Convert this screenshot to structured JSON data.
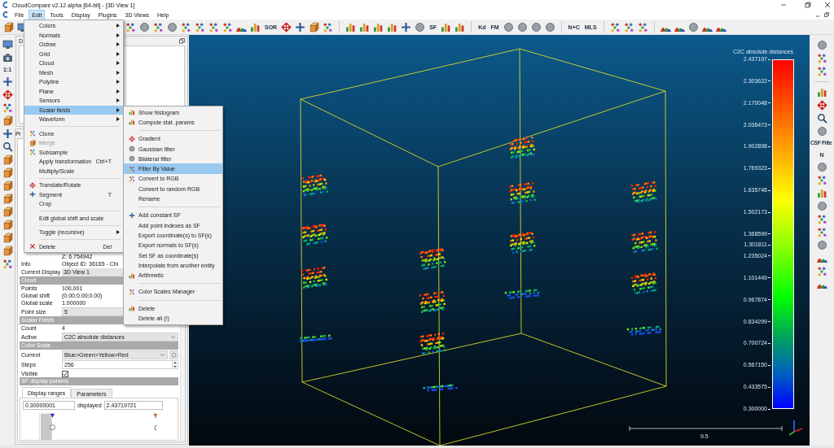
{
  "window": {
    "title": "CloudCompare v2.12 alpha [64-bit] - [3D View 1]"
  },
  "menubar": [
    {
      "label": "File",
      "selected": false
    },
    {
      "label": "Edit",
      "selected": true
    },
    {
      "label": "Tools",
      "selected": false
    },
    {
      "label": "Display",
      "selected": false
    },
    {
      "label": "Plugins",
      "selected": false
    },
    {
      "label": "3D Views",
      "selected": false
    },
    {
      "label": "Help",
      "selected": false
    }
  ],
  "toolbar": [
    {
      "kind": "cube"
    },
    {
      "kind": "screen"
    },
    {
      "kind": "gap"
    },
    {
      "kind": "dots"
    },
    {
      "kind": "circle"
    },
    {
      "kind": "dots"
    },
    {
      "kind": "circle"
    },
    {
      "kind": "dots"
    },
    {
      "kind": "dots"
    },
    {
      "kind": "dots"
    },
    {
      "kind": "dots"
    },
    {
      "kind": "hill"
    },
    {
      "kind": "chart"
    },
    {
      "kind": "label",
      "label": "SOR"
    },
    {
      "kind": "cross"
    },
    {
      "kind": "plus"
    },
    {
      "kind": "cube"
    },
    {
      "kind": "dots"
    },
    {
      "kind": "sep"
    },
    {
      "kind": "chart"
    },
    {
      "kind": "chart"
    },
    {
      "kind": "chart"
    },
    {
      "kind": "chart"
    },
    {
      "kind": "plus"
    },
    {
      "kind": "circle"
    },
    {
      "kind": "label",
      "label": "SF"
    },
    {
      "kind": "chart"
    },
    {
      "kind": "chart"
    },
    {
      "kind": "sep"
    },
    {
      "kind": "label",
      "label": "Kd"
    },
    {
      "kind": "label",
      "label": "FM"
    },
    {
      "kind": "circle"
    },
    {
      "kind": "circle"
    },
    {
      "kind": "circle"
    },
    {
      "kind": "circle"
    },
    {
      "kind": "sep"
    },
    {
      "kind": "label",
      "label": "N+C"
    },
    {
      "kind": "label",
      "label": "MLS"
    },
    {
      "kind": "sep"
    },
    {
      "kind": "dots"
    },
    {
      "kind": "dots"
    },
    {
      "kind": "dots"
    },
    {
      "kind": "sep"
    },
    {
      "kind": "hill"
    },
    {
      "kind": "hill"
    },
    {
      "kind": "circle"
    },
    {
      "kind": "hill"
    },
    {
      "kind": "hill"
    }
  ],
  "left_toolbar": [
    {
      "kind": "screen"
    },
    {
      "kind": "camera"
    },
    {
      "kind": "label",
      "label": "1:1"
    },
    {
      "kind": "plus"
    },
    {
      "kind": "cross"
    },
    {
      "kind": "dots"
    },
    {
      "kind": "cube"
    },
    {
      "kind": "plus"
    },
    {
      "kind": "search"
    },
    {
      "kind": "cube"
    },
    {
      "kind": "cube"
    },
    {
      "kind": "cube"
    },
    {
      "kind": "cube"
    },
    {
      "kind": "cube"
    },
    {
      "kind": "cube"
    },
    {
      "kind": "cube"
    },
    {
      "kind": "cube"
    },
    {
      "kind": "dots"
    }
  ],
  "right_toolbar": [
    {
      "kind": "circle"
    },
    {
      "kind": "dots"
    },
    {
      "kind": "dots"
    },
    {
      "kind": "sep"
    },
    {
      "kind": "chart"
    },
    {
      "kind": "cross"
    },
    {
      "kind": "search"
    },
    {
      "kind": "circle"
    },
    {
      "kind": "label",
      "label": "CSF Filte"
    },
    {
      "kind": "label",
      "label": "N"
    },
    {
      "kind": "circle"
    },
    {
      "kind": "dots"
    },
    {
      "kind": "chart"
    },
    {
      "kind": "circle"
    },
    {
      "kind": "dots"
    },
    {
      "kind": "dots"
    },
    {
      "kind": "circle"
    },
    {
      "kind": "hill"
    },
    {
      "kind": "dots"
    },
    {
      "kind": "hill"
    }
  ],
  "db_dock": {
    "title": "D"
  },
  "properties_dock": {
    "title": "Pr",
    "rows": [
      {
        "kind": "plain",
        "value": "Z: 6.754942"
      },
      {
        "kind": "field",
        "key": "Info",
        "value": "Object ID: 36165 - Chi"
      },
      {
        "kind": "box",
        "key": "Current Display",
        "value": "3D View 1"
      },
      {
        "kind": "header",
        "label": "Cloud"
      },
      {
        "kind": "field",
        "key": "Points",
        "value": "100,001"
      },
      {
        "kind": "field",
        "key": "Global shift",
        "value": "(0.00;0.00;0.00)"
      },
      {
        "kind": "field",
        "key": "Global scale",
        "value": "1.000000"
      },
      {
        "kind": "combo",
        "key": "Point size",
        "value": "5"
      },
      {
        "kind": "header",
        "label": "Scalar Fields"
      },
      {
        "kind": "field",
        "key": "Count",
        "value": "4"
      },
      {
        "kind": "combo",
        "key": "Active",
        "value": "C2C absolute distances"
      },
      {
        "kind": "header",
        "label": "Color Scale"
      },
      {
        "kind": "combo_gear",
        "key": "Current",
        "value": "Blue>Green>Yellow>Red"
      },
      {
        "kind": "spin",
        "key": "Steps",
        "value": "256"
      },
      {
        "kind": "check",
        "key": "Visible",
        "checked": true
      },
      {
        "kind": "header",
        "label": "SF display params"
      }
    ],
    "tabs": [
      {
        "label": "Display ranges",
        "selected": true
      },
      {
        "label": "Parameters",
        "selected": false
      }
    ],
    "range_min": "0.30000001",
    "range_caption": "displayed",
    "range_max": "2.43719721"
  },
  "edit_menu": {
    "items": [
      {
        "kind": "submenu",
        "label": "Colors",
        "selected": false,
        "disabled": false
      },
      {
        "kind": "submenu",
        "label": "Normals",
        "selected": false,
        "disabled": false
      },
      {
        "kind": "submenu",
        "label": "Octree",
        "selected": false,
        "disabled": false
      },
      {
        "kind": "submenu",
        "label": "Grid",
        "selected": false,
        "disabled": false
      },
      {
        "kind": "submenu",
        "label": "Cloud",
        "selected": false,
        "disabled": false
      },
      {
        "kind": "submenu",
        "label": "Mesh",
        "selected": false,
        "disabled": false
      },
      {
        "kind": "submenu",
        "label": "Polyline",
        "selected": false,
        "disabled": false
      },
      {
        "kind": "submenu",
        "label": "Plane",
        "selected": false,
        "disabled": false
      },
      {
        "kind": "submenu",
        "label": "Sensors",
        "selected": false,
        "disabled": false
      },
      {
        "kind": "submenu",
        "label": "Scalar fields",
        "selected": true,
        "disabled": false
      },
      {
        "kind": "submenu",
        "label": "Waveform",
        "selected": false,
        "disabled": false
      },
      {
        "kind": "separator"
      },
      {
        "kind": "action",
        "label": "Clone",
        "selected": false,
        "disabled": false
      },
      {
        "kind": "action",
        "label": "Merge",
        "selected": false,
        "disabled": true
      },
      {
        "kind": "action",
        "label": "Subsample",
        "selected": false,
        "disabled": false
      },
      {
        "kind": "action",
        "label": "Apply transformation",
        "shortcut": "Ctrl+T",
        "selected": false,
        "disabled": false
      },
      {
        "kind": "action",
        "label": "Multiply/Scale",
        "selected": false,
        "disabled": false
      },
      {
        "kind": "separator"
      },
      {
        "kind": "action",
        "label": "Translate/Rotate",
        "selected": false,
        "disabled": false
      },
      {
        "kind": "action",
        "label": "Segment",
        "shortcut": "T",
        "selected": false,
        "disabled": false
      },
      {
        "kind": "action",
        "label": "Crop",
        "selected": false,
        "disabled": false
      },
      {
        "kind": "separator"
      },
      {
        "kind": "action",
        "label": "Edit global shift and scale",
        "selected": false,
        "disabled": false
      },
      {
        "kind": "separator"
      },
      {
        "kind": "submenu",
        "label": "Toggle (recursive)",
        "selected": false,
        "disabled": false
      },
      {
        "kind": "separator"
      },
      {
        "kind": "action",
        "label": "Delete",
        "shortcut": "Del",
        "selected": false,
        "disabled": false
      }
    ]
  },
  "scalar_fields_menu": {
    "items": [
      {
        "kind": "action",
        "label": "Show histogram",
        "selected": false
      },
      {
        "kind": "action",
        "label": "Compute stat. params",
        "selected": false
      },
      {
        "kind": "separator"
      },
      {
        "kind": "action",
        "label": "Gradient",
        "selected": false
      },
      {
        "kind": "action",
        "label": "Gaussian filter",
        "selected": false
      },
      {
        "kind": "action",
        "label": "Bilateral filter",
        "selected": false
      },
      {
        "kind": "action",
        "label": "Filter By Value",
        "selected": true
      },
      {
        "kind": "action",
        "label": "Convert to RGB",
        "selected": false
      },
      {
        "kind": "action",
        "label": "Convert to random RGB",
        "selected": false
      },
      {
        "kind": "action",
        "label": "Rename",
        "selected": false
      },
      {
        "kind": "separator"
      },
      {
        "kind": "action",
        "label": "Add constant SF",
        "selected": false
      },
      {
        "kind": "action",
        "label": "Add point indexes as SF",
        "selected": false
      },
      {
        "kind": "action",
        "label": "Export coordinate(s) to SF(s)",
        "selected": false
      },
      {
        "kind": "action",
        "label": "Export normals to SF(s)",
        "selected": false
      },
      {
        "kind": "action",
        "label": "Set SF as coordinate(s)",
        "selected": false
      },
      {
        "kind": "action",
        "label": "Interpolate from another entity",
        "selected": false
      },
      {
        "kind": "action",
        "label": "Arithmetic",
        "selected": false
      },
      {
        "kind": "separator"
      },
      {
        "kind": "action",
        "label": "Color Scales Manager",
        "selected": false
      },
      {
        "kind": "separator"
      },
      {
        "kind": "action",
        "label": "Delete",
        "selected": false
      },
      {
        "kind": "action",
        "label": "Delete all (!)",
        "selected": false
      }
    ]
  },
  "view": {
    "color_scale": {
      "title": "C2C absolute distances",
      "labels": [
        "2.437197",
        "2.303622",
        "2.170048",
        "2.036473",
        "1.902898",
        "1.769323",
        "1.635748",
        "1.502173",
        "1.368599",
        "1.301811",
        "1.235024",
        "1.101449",
        "0.967874",
        "0.834299",
        "0.700724",
        "0.567150",
        "0.433575",
        "0.300000"
      ]
    },
    "scale_bar": {
      "label": "9.5"
    }
  }
}
